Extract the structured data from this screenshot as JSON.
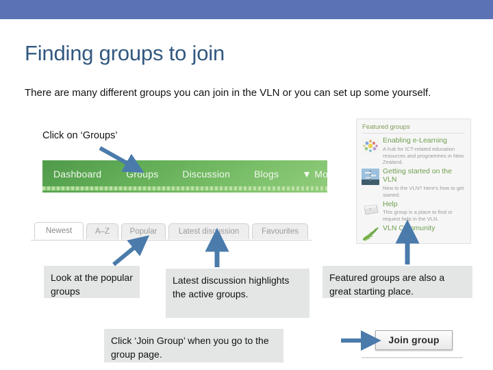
{
  "slide": {
    "title": "Finding groups to join",
    "intro": "There are many different groups you can join in the VLN or you can set up some yourself.",
    "click_groups_label": "Click on ‘Groups’",
    "band_color": "#5b72b4",
    "title_color": "#33587f",
    "arrow_color": "#4a7bab"
  },
  "navbar": {
    "items": [
      {
        "label": "Dashboard"
      },
      {
        "label": "Groups"
      },
      {
        "label": "Discussion"
      },
      {
        "label": "Blogs"
      },
      {
        "label": "▼ More"
      }
    ]
  },
  "tabs": [
    {
      "label": "Newest",
      "active": true
    },
    {
      "label": "A–Z",
      "active": false
    },
    {
      "label": "Popular",
      "active": false
    },
    {
      "label": "Latest discussion",
      "active": false
    },
    {
      "label": "Favourites",
      "active": false
    }
  ],
  "featured_panel": {
    "title": "Featured groups",
    "groups": [
      {
        "name": "Enabling e-Learning",
        "desc": "A hub for ICT-related education resources and programmes in New Zealand.",
        "icon": "burst-icon"
      },
      {
        "name": "Getting started on the VLN",
        "desc": "New to the VLN? Here's how to get started.",
        "icon": "signpost-icon"
      },
      {
        "name": "Help",
        "desc": "This group is a place to find or request help in the VLN.",
        "icon": "keyboard-key-icon"
      },
      {
        "name": "VLN Community",
        "desc": "",
        "icon": "fern-icon"
      }
    ]
  },
  "callouts": {
    "popular": "Look at the popular groups",
    "latest": "Latest discussion highlights the active groups.",
    "featured": "Featured groups are also a great starting place.",
    "join_group": "Click ‘Join Group’ when you go to the group page."
  },
  "join_group_button": {
    "label": "Join group"
  }
}
